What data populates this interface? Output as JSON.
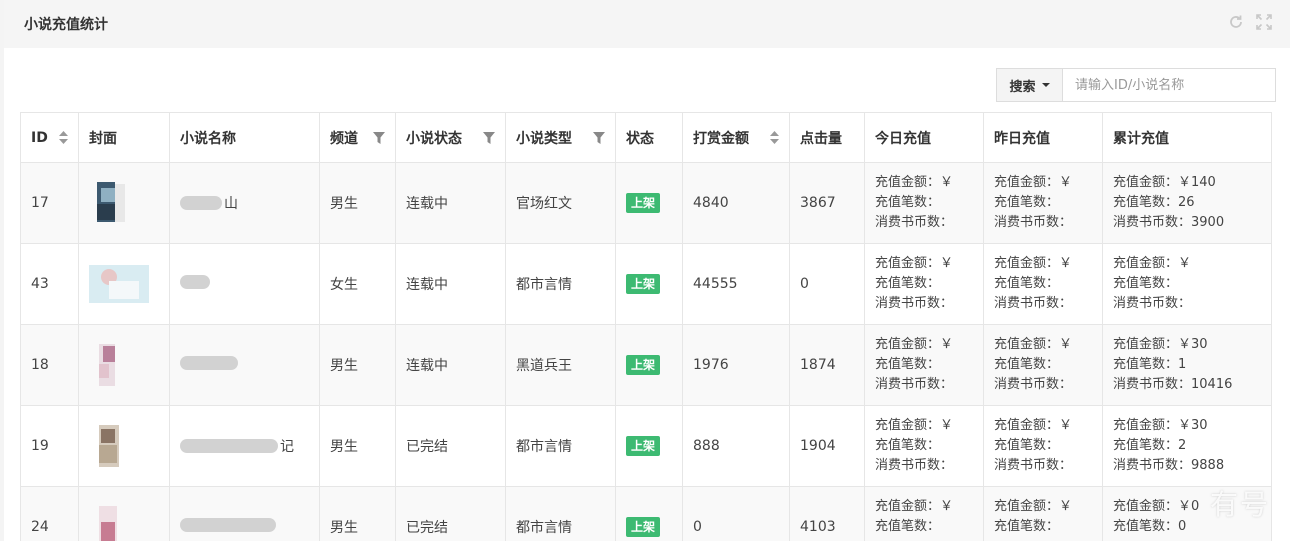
{
  "panel": {
    "title": "小说充值统计"
  },
  "toolbar": {
    "search_label": "搜索",
    "search_placeholder": "请输入ID/小说名称"
  },
  "table": {
    "headers": {
      "id": "ID",
      "cover": "封面",
      "name": "小说名称",
      "channel": "频道",
      "novel_status": "小说状态",
      "novel_type": "小说类型",
      "status": "状态",
      "reward": "打赏金额",
      "clicks": "点击量",
      "today": "今日充值",
      "yesterday": "昨日充值",
      "total": "累计充值"
    },
    "rows": [
      {
        "id": "17",
        "name": "山",
        "channel": "男生",
        "novel_status": "连载中",
        "novel_type": "官场红文",
        "status": "上架",
        "reward": "4840",
        "clicks": "3867",
        "today": [
          "充值金额：￥",
          "充值笔数：",
          "消费书币数："
        ],
        "yesterday": [
          "充值金额：￥",
          "充值笔数：",
          "消费书币数："
        ],
        "total": [
          "充值金额：￥140",
          "充值笔数：26",
          "消费书币数：3900"
        ]
      },
      {
        "id": "43",
        "name": "",
        "channel": "女生",
        "novel_status": "连载中",
        "novel_type": "都市言情",
        "status": "上架",
        "reward": "44555",
        "clicks": "0",
        "today": [
          "充值金额：￥",
          "充值笔数：",
          "消费书币数："
        ],
        "yesterday": [
          "充值金额：￥",
          "充值笔数：",
          "消费书币数："
        ],
        "total": [
          "充值金额：￥",
          "充值笔数：",
          "消费书币数："
        ]
      },
      {
        "id": "18",
        "name": "",
        "channel": "男生",
        "novel_status": "连载中",
        "novel_type": "黑道兵王",
        "status": "上架",
        "reward": "1976",
        "clicks": "1874",
        "today": [
          "充值金额：￥",
          "充值笔数：",
          "消费书币数："
        ],
        "yesterday": [
          "充值金额：￥",
          "充值笔数：",
          "消费书币数："
        ],
        "total": [
          "充值金额：￥30",
          "充值笔数：1",
          "消费书币数：10416"
        ]
      },
      {
        "id": "19",
        "name": "记",
        "channel": "男生",
        "novel_status": "已完结",
        "novel_type": "都市言情",
        "status": "上架",
        "reward": "888",
        "clicks": "1904",
        "today": [
          "充值金额：￥",
          "充值笔数：",
          "消费书币数："
        ],
        "yesterday": [
          "充值金额：￥",
          "充值笔数：",
          "消费书币数："
        ],
        "total": [
          "充值金额：￥30",
          "充值笔数：2",
          "消费书币数：9888"
        ]
      },
      {
        "id": "24",
        "name": "",
        "channel": "男生",
        "novel_status": "已完结",
        "novel_type": "都市言情",
        "status": "上架",
        "reward": "0",
        "clicks": "4103",
        "today": [
          "充值金额：￥",
          "充值笔数："
        ],
        "yesterday": [
          "充值金额：￥",
          "充值笔数："
        ],
        "total": [
          "充值金额：￥0",
          "充值笔数：0"
        ]
      }
    ]
  },
  "watermark": "有号",
  "colors": {
    "badge": "#3dba72",
    "header_bg": "#f5f5f5",
    "row_stripe": "#f9f9f9",
    "border": "#e6e6e6"
  }
}
